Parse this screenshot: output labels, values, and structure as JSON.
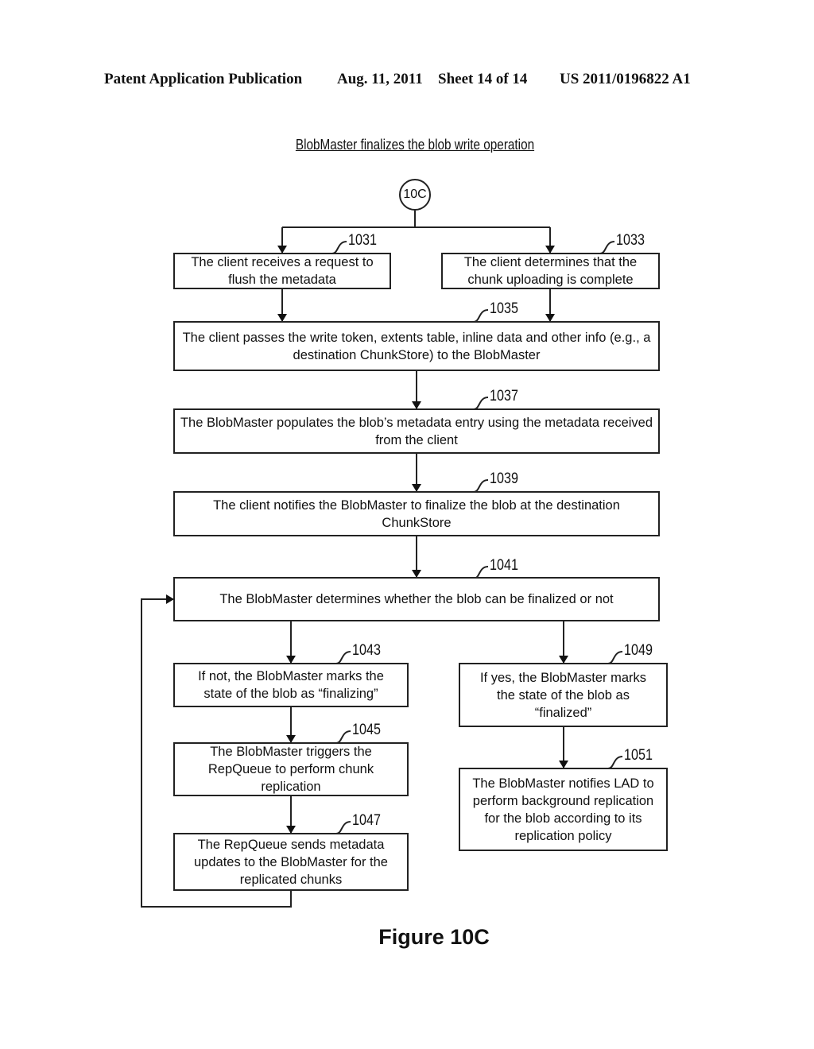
{
  "header": {
    "left": "Patent Application Publication",
    "date": "Aug. 11, 2011",
    "sheet": "Sheet 14 of 14",
    "pub_number": "US 2011/0196822 A1"
  },
  "diagram": {
    "title": "BlobMaster finalizes the blob write operation",
    "start_connector": "10C",
    "steps": {
      "s1031": {
        "ref": "1031",
        "text": "The client receives a request to flush the metadata"
      },
      "s1033": {
        "ref": "1033",
        "text": "The client determines that the chunk uploading is complete"
      },
      "s1035": {
        "ref": "1035",
        "text": "The client passes the write token, extents table, inline data and other info (e.g., a destination ChunkStore) to the BlobMaster"
      },
      "s1037": {
        "ref": "1037",
        "text": "The BlobMaster populates the blob’s metadata entry using the metadata received from the client"
      },
      "s1039": {
        "ref": "1039",
        "text": "The client notifies the BlobMaster to finalize the blob at the destination ChunkStore"
      },
      "s1041": {
        "ref": "1041",
        "text": "The BlobMaster determines whether the blob can be finalized or not"
      },
      "s1043": {
        "ref": "1043",
        "text": "If not, the BlobMaster marks the state of the blob as “finalizing”"
      },
      "s1045": {
        "ref": "1045",
        "text": "The BlobMaster triggers the RepQueue to perform chunk replication"
      },
      "s1047": {
        "ref": "1047",
        "text": "The RepQueue sends metadata updates to the BlobMaster for the replicated chunks"
      },
      "s1049": {
        "ref": "1049",
        "text": "If yes, the BlobMaster marks the state of the blob as “finalized”"
      },
      "s1051": {
        "ref": "1051",
        "text": "The BlobMaster notifies LAD to perform background replication for the blob according to its replication policy"
      }
    },
    "edges": [
      [
        "10C",
        "1031"
      ],
      [
        "10C",
        "1033"
      ],
      [
        "1031",
        "1035"
      ],
      [
        "1033",
        "1035"
      ],
      [
        "1035",
        "1037"
      ],
      [
        "1037",
        "1039"
      ],
      [
        "1039",
        "1041"
      ],
      [
        "1041",
        "1043"
      ],
      [
        "1041",
        "1049"
      ],
      [
        "1043",
        "1045"
      ],
      [
        "1045",
        "1047"
      ],
      [
        "1047",
        "1041"
      ],
      [
        "1049",
        "1051"
      ]
    ],
    "figure_label": "Figure 10C"
  }
}
